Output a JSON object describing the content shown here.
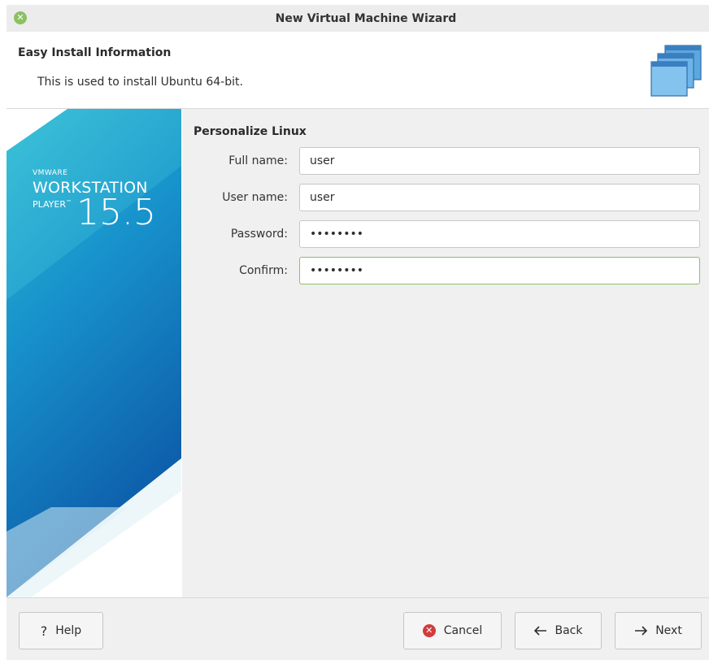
{
  "window": {
    "title": "New Virtual Machine Wizard",
    "close_icon": "close-icon"
  },
  "header": {
    "title": "Easy Install Information",
    "subtitle": "This is used to install Ubuntu 64-bit.",
    "logo_icon": "stacked-windows-icon"
  },
  "banner": {
    "vendor": "VMWARE",
    "product": "WORKSTATION",
    "edition": "PLAYER",
    "trademark": "™",
    "version": "15.5",
    "colors": {
      "top": "#29b8cf",
      "bottom": "#0f63b0"
    }
  },
  "form": {
    "section_title": "Personalize Linux",
    "fields": [
      {
        "label": "Full name:",
        "value": "user",
        "type": "text"
      },
      {
        "label": "User name:",
        "value": "user",
        "type": "text"
      },
      {
        "label": "Password:",
        "value": "••••••••",
        "type": "password"
      },
      {
        "label": "Confirm:",
        "value": "••••••••",
        "type": "password",
        "focused": true
      }
    ]
  },
  "footer": {
    "help_label": "Help",
    "help_icon": "question-icon",
    "cancel_label": "Cancel",
    "cancel_icon": "cancel-icon",
    "back_label": "Back",
    "back_icon": "arrow-left-icon",
    "next_label": "Next",
    "next_icon": "arrow-right-icon"
  },
  "colors": {
    "focus_border": "#8fbf6a",
    "cancel_red": "#d33c3c",
    "close_green": "#8cc063"
  }
}
